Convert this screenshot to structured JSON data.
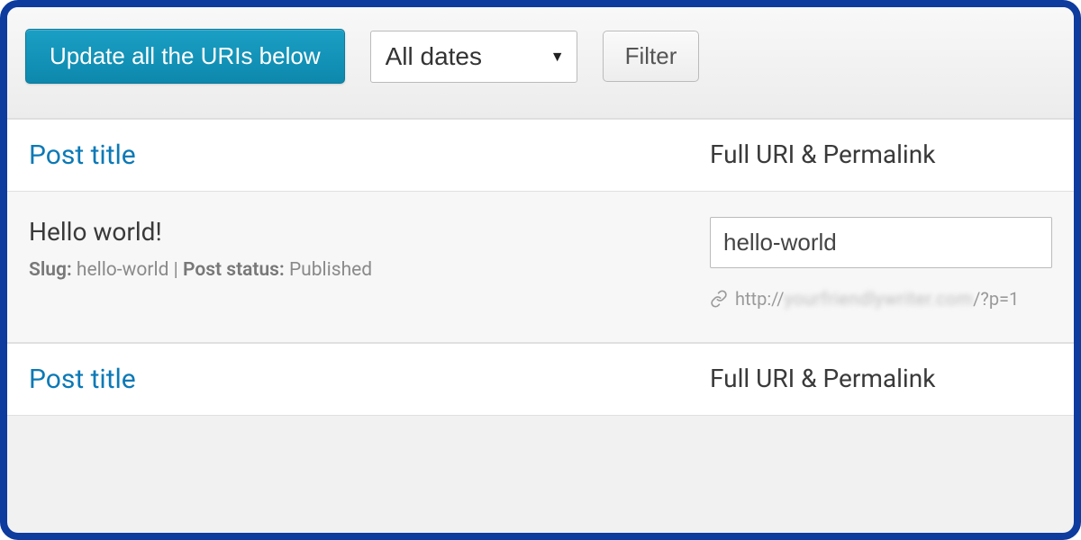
{
  "toolbar": {
    "update_button": "Update all the URIs below",
    "date_filter_selected": "All dates",
    "filter_button": "Filter"
  },
  "table": {
    "headers": {
      "title": "Post title",
      "uri": "Full URI & Permalink"
    },
    "row": {
      "post_title": "Hello world!",
      "slug_label": "Slug:",
      "slug_value": "hello-world",
      "status_label": "Post status:",
      "status_value": "Published",
      "separator": " | ",
      "uri_input_value": "hello-world",
      "permalink_prefix": "http://",
      "permalink_blurred": "yourfriendlywriter.com",
      "permalink_suffix": "/?p=1"
    },
    "footers": {
      "title": "Post title",
      "uri": "Full URI & Permalink"
    }
  }
}
